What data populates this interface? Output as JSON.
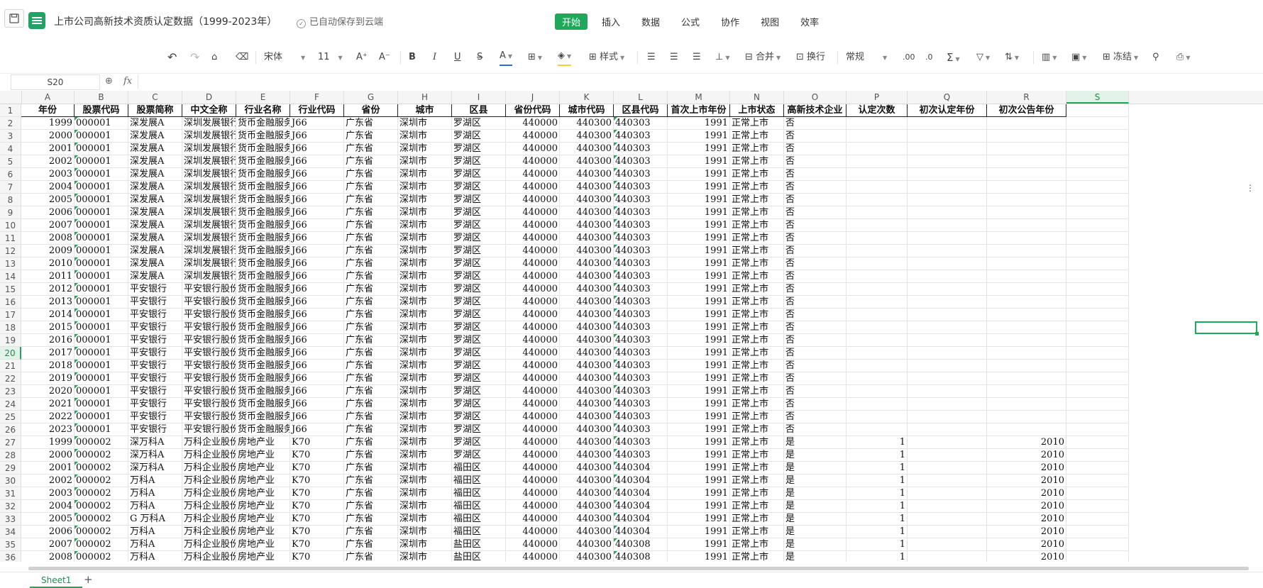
{
  "title": {
    "doc_title": "上市公司高新技术资质认定数据（1999-2023年）",
    "autosave": "已自动保存到云端"
  },
  "menu": [
    "开始",
    "插入",
    "数据",
    "公式",
    "协作",
    "视图",
    "效率"
  ],
  "toolbar": {
    "font_name": "宋体",
    "font_size": "11",
    "style_label": "样式",
    "merge_label": "合并",
    "wrap_label": "换行",
    "number_format": "常规",
    "freeze_label": "冻结",
    "fx": "fx"
  },
  "formula_bar": {
    "cell_ref": "S20",
    "content": ""
  },
  "columns": [
    "A",
    "B",
    "C",
    "D",
    "E",
    "F",
    "G",
    "H",
    "I",
    "J",
    "K",
    "L",
    "M",
    "N",
    "O",
    "P",
    "Q",
    "R",
    "S"
  ],
  "selected_column": "S",
  "selected_row": 20,
  "headers": [
    "年份",
    "股票代码",
    "股票简称",
    "中文全称",
    "行业名称",
    "行业代码",
    "省份",
    "城市",
    "区县",
    "省份代码",
    "城市代码",
    "区县代码",
    "首次上市年份",
    "上市状态",
    "高新技术企业",
    "认定次数",
    "初次认定年份",
    "初次公告年份"
  ],
  "rows": [
    [
      "1999",
      "000001",
      "深发展A",
      "深圳发展银行",
      "货币金融服务",
      "J66",
      "广东省",
      "深圳市",
      "罗湖区",
      "440000",
      "440300",
      "440303",
      "1991",
      "正常上市",
      "否",
      "",
      "",
      ""
    ],
    [
      "2000",
      "000001",
      "深发展A",
      "深圳发展银行",
      "货币金融服务",
      "J66",
      "广东省",
      "深圳市",
      "罗湖区",
      "440000",
      "440300",
      "440303",
      "1991",
      "正常上市",
      "否",
      "",
      "",
      ""
    ],
    [
      "2001",
      "000001",
      "深发展A",
      "深圳发展银行",
      "货币金融服务",
      "J66",
      "广东省",
      "深圳市",
      "罗湖区",
      "440000",
      "440300",
      "440303",
      "1991",
      "正常上市",
      "否",
      "",
      "",
      ""
    ],
    [
      "2002",
      "000001",
      "深发展A",
      "深圳发展银行",
      "货币金融服务",
      "J66",
      "广东省",
      "深圳市",
      "罗湖区",
      "440000",
      "440300",
      "440303",
      "1991",
      "正常上市",
      "否",
      "",
      "",
      ""
    ],
    [
      "2003",
      "000001",
      "深发展A",
      "深圳发展银行",
      "货币金融服务",
      "J66",
      "广东省",
      "深圳市",
      "罗湖区",
      "440000",
      "440300",
      "440303",
      "1991",
      "正常上市",
      "否",
      "",
      "",
      ""
    ],
    [
      "2004",
      "000001",
      "深发展A",
      "深圳发展银行",
      "货币金融服务",
      "J66",
      "广东省",
      "深圳市",
      "罗湖区",
      "440000",
      "440300",
      "440303",
      "1991",
      "正常上市",
      "否",
      "",
      "",
      ""
    ],
    [
      "2005",
      "000001",
      "深发展A",
      "深圳发展银行",
      "货币金融服务",
      "J66",
      "广东省",
      "深圳市",
      "罗湖区",
      "440000",
      "440300",
      "440303",
      "1991",
      "正常上市",
      "否",
      "",
      "",
      ""
    ],
    [
      "2006",
      "000001",
      "深发展A",
      "深圳发展银行",
      "货币金融服务",
      "J66",
      "广东省",
      "深圳市",
      "罗湖区",
      "440000",
      "440300",
      "440303",
      "1991",
      "正常上市",
      "否",
      "",
      "",
      ""
    ],
    [
      "2007",
      "000001",
      "深发展A",
      "深圳发展银行",
      "货币金融服务",
      "J66",
      "广东省",
      "深圳市",
      "罗湖区",
      "440000",
      "440300",
      "440303",
      "1991",
      "正常上市",
      "否",
      "",
      "",
      ""
    ],
    [
      "2008",
      "000001",
      "深发展A",
      "深圳发展银行",
      "货币金融服务",
      "J66",
      "广东省",
      "深圳市",
      "罗湖区",
      "440000",
      "440300",
      "440303",
      "1991",
      "正常上市",
      "否",
      "",
      "",
      ""
    ],
    [
      "2009",
      "000001",
      "深发展A",
      "深圳发展银行",
      "货币金融服务",
      "J66",
      "广东省",
      "深圳市",
      "罗湖区",
      "440000",
      "440300",
      "440303",
      "1991",
      "正常上市",
      "否",
      "",
      "",
      ""
    ],
    [
      "2010",
      "000001",
      "深发展A",
      "深圳发展银行",
      "货币金融服务",
      "J66",
      "广东省",
      "深圳市",
      "罗湖区",
      "440000",
      "440300",
      "440303",
      "1991",
      "正常上市",
      "否",
      "",
      "",
      ""
    ],
    [
      "2011",
      "000001",
      "深发展A",
      "深圳发展银行",
      "货币金融服务",
      "J66",
      "广东省",
      "深圳市",
      "罗湖区",
      "440000",
      "440300",
      "440303",
      "1991",
      "正常上市",
      "否",
      "",
      "",
      ""
    ],
    [
      "2012",
      "000001",
      "平安银行",
      "平安银行股份",
      "货币金融服务",
      "J66",
      "广东省",
      "深圳市",
      "罗湖区",
      "440000",
      "440300",
      "440303",
      "1991",
      "正常上市",
      "否",
      "",
      "",
      ""
    ],
    [
      "2013",
      "000001",
      "平安银行",
      "平安银行股份",
      "货币金融服务",
      "J66",
      "广东省",
      "深圳市",
      "罗湖区",
      "440000",
      "440300",
      "440303",
      "1991",
      "正常上市",
      "否",
      "",
      "",
      ""
    ],
    [
      "2014",
      "000001",
      "平安银行",
      "平安银行股份",
      "货币金融服务",
      "J66",
      "广东省",
      "深圳市",
      "罗湖区",
      "440000",
      "440300",
      "440303",
      "1991",
      "正常上市",
      "否",
      "",
      "",
      ""
    ],
    [
      "2015",
      "000001",
      "平安银行",
      "平安银行股份",
      "货币金融服务",
      "J66",
      "广东省",
      "深圳市",
      "罗湖区",
      "440000",
      "440300",
      "440303",
      "1991",
      "正常上市",
      "否",
      "",
      "",
      ""
    ],
    [
      "2016",
      "000001",
      "平安银行",
      "平安银行股份",
      "货币金融服务",
      "J66",
      "广东省",
      "深圳市",
      "罗湖区",
      "440000",
      "440300",
      "440303",
      "1991",
      "正常上市",
      "否",
      "",
      "",
      ""
    ],
    [
      "2017",
      "000001",
      "平安银行",
      "平安银行股份",
      "货币金融服务",
      "J66",
      "广东省",
      "深圳市",
      "罗湖区",
      "440000",
      "440300",
      "440303",
      "1991",
      "正常上市",
      "否",
      "",
      "",
      ""
    ],
    [
      "2018",
      "000001",
      "平安银行",
      "平安银行股份",
      "货币金融服务",
      "J66",
      "广东省",
      "深圳市",
      "罗湖区",
      "440000",
      "440300",
      "440303",
      "1991",
      "正常上市",
      "否",
      "",
      "",
      ""
    ],
    [
      "2019",
      "000001",
      "平安银行",
      "平安银行股份",
      "货币金融服务",
      "J66",
      "广东省",
      "深圳市",
      "罗湖区",
      "440000",
      "440300",
      "440303",
      "1991",
      "正常上市",
      "否",
      "",
      "",
      ""
    ],
    [
      "2020",
      "000001",
      "平安银行",
      "平安银行股份",
      "货币金融服务",
      "J66",
      "广东省",
      "深圳市",
      "罗湖区",
      "440000",
      "440300",
      "440303",
      "1991",
      "正常上市",
      "否",
      "",
      "",
      ""
    ],
    [
      "2021",
      "000001",
      "平安银行",
      "平安银行股份",
      "货币金融服务",
      "J66",
      "广东省",
      "深圳市",
      "罗湖区",
      "440000",
      "440300",
      "440303",
      "1991",
      "正常上市",
      "否",
      "",
      "",
      ""
    ],
    [
      "2022",
      "000001",
      "平安银行",
      "平安银行股份",
      "货币金融服务",
      "J66",
      "广东省",
      "深圳市",
      "罗湖区",
      "440000",
      "440300",
      "440303",
      "1991",
      "正常上市",
      "否",
      "",
      "",
      ""
    ],
    [
      "2023",
      "000001",
      "平安银行",
      "平安银行股份",
      "货币金融服务",
      "J66",
      "广东省",
      "深圳市",
      "罗湖区",
      "440000",
      "440300",
      "440303",
      "1991",
      "正常上市",
      "否",
      "",
      "",
      ""
    ],
    [
      "1999",
      "000002",
      "深万科A",
      "万科企业股份",
      "房地产业",
      "K70",
      "广东省",
      "深圳市",
      "罗湖区",
      "440000",
      "440300",
      "440303",
      "1991",
      "正常上市",
      "是",
      "1",
      "",
      "2010"
    ],
    [
      "2000",
      "000002",
      "深万科A",
      "万科企业股份",
      "房地产业",
      "K70",
      "广东省",
      "深圳市",
      "罗湖区",
      "440000",
      "440300",
      "440303",
      "1991",
      "正常上市",
      "是",
      "1",
      "",
      "2010"
    ],
    [
      "2001",
      "000002",
      "深万科A",
      "万科企业股份",
      "房地产业",
      "K70",
      "广东省",
      "深圳市",
      "福田区",
      "440000",
      "440300",
      "440304",
      "1991",
      "正常上市",
      "是",
      "1",
      "",
      "2010"
    ],
    [
      "2002",
      "000002",
      "万科A",
      "万科企业股份",
      "房地产业",
      "K70",
      "广东省",
      "深圳市",
      "福田区",
      "440000",
      "440300",
      "440304",
      "1991",
      "正常上市",
      "是",
      "1",
      "",
      "2010"
    ],
    [
      "2003",
      "000002",
      "万科A",
      "万科企业股份",
      "房地产业",
      "K70",
      "广东省",
      "深圳市",
      "福田区",
      "440000",
      "440300",
      "440304",
      "1991",
      "正常上市",
      "是",
      "1",
      "",
      "2010"
    ],
    [
      "2004",
      "000002",
      "万科A",
      "万科企业股份",
      "房地产业",
      "K70",
      "广东省",
      "深圳市",
      "福田区",
      "440000",
      "440300",
      "440304",
      "1991",
      "正常上市",
      "是",
      "1",
      "",
      "2010"
    ],
    [
      "2005",
      "000002",
      "G 万科A",
      "万科企业股份",
      "房地产业",
      "K70",
      "广东省",
      "深圳市",
      "福田区",
      "440000",
      "440300",
      "440304",
      "1991",
      "正常上市",
      "是",
      "1",
      "",
      "2010"
    ],
    [
      "2006",
      "000002",
      "万科A",
      "万科企业股份",
      "房地产业",
      "K70",
      "广东省",
      "深圳市",
      "福田区",
      "440000",
      "440300",
      "440304",
      "1991",
      "正常上市",
      "是",
      "1",
      "",
      "2010"
    ],
    [
      "2007",
      "000002",
      "万科A",
      "万科企业股份",
      "房地产业",
      "K70",
      "广东省",
      "深圳市",
      "盐田区",
      "440000",
      "440300",
      "440308",
      "1991",
      "正常上市",
      "是",
      "1",
      "",
      "2010"
    ],
    [
      "2008",
      "000002",
      "万科A",
      "万科企业股份",
      "房地产业",
      "K70",
      "广东省",
      "深圳市",
      "盐田区",
      "440000",
      "440300",
      "440308",
      "1991",
      "正常上市",
      "是",
      "1",
      "",
      "2010"
    ]
  ],
  "sheet_tabs": [
    "Sheet1"
  ]
}
